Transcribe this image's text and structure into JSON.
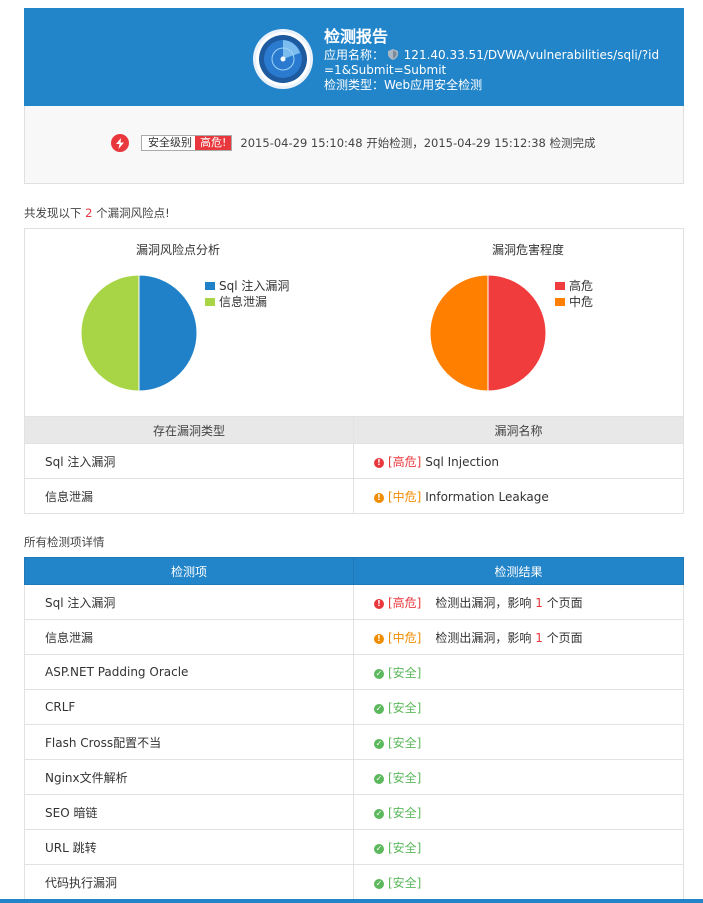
{
  "header": {
    "title": "检测报告",
    "app_name_label": "应用名称：",
    "app_url": "121.40.33.51/DVWA/vulnerabilities/sqli/?id=1&Submit=Submit",
    "scan_type_label": "检测类型：",
    "scan_type": "Web应用安全检测"
  },
  "summary": {
    "level_label": "安全级别",
    "level_value": "高危!",
    "time_text": "2015-04-29 15:10:48 开始检测，2015-04-29 15:12:38 检测完成"
  },
  "found": {
    "prefix": "共发现以下 ",
    "count": "2",
    "suffix": " 个漏洞风险点!"
  },
  "chart_data": [
    {
      "type": "pie",
      "title": "漏洞风险点分析",
      "categories": [
        "Sql 注入漏洞",
        "信息泄漏"
      ],
      "values": [
        1,
        1
      ],
      "colors": [
        "#2081c8",
        "#a8d545"
      ],
      "legend": "right"
    },
    {
      "type": "pie",
      "title": "漏洞危害程度",
      "categories": [
        "高危",
        "中危"
      ],
      "values": [
        1,
        1
      ],
      "colors": [
        "#f03c3c",
        "#ff7f00"
      ],
      "legend": "right"
    }
  ],
  "vuln_table": {
    "headers": [
      "存在漏洞类型",
      "漏洞名称"
    ],
    "rows": [
      {
        "type": "Sql 注入漏洞",
        "level": "高危",
        "tag": "[高危]",
        "name": "Sql Injection"
      },
      {
        "type": "信息泄漏",
        "level": "中危",
        "tag": "[中危]",
        "name": "Information Leakage"
      }
    ]
  },
  "details": {
    "label": "所有检测项详情",
    "headers": [
      "检测项",
      "检测结果"
    ],
    "rows": [
      {
        "item": "Sql 注入漏洞",
        "status": "high",
        "tag": "[高危]",
        "result_prefix": "检测出漏洞，影响 ",
        "count": "1",
        "result_suffix": " 个页面"
      },
      {
        "item": "信息泄漏",
        "status": "mid",
        "tag": "[中危]",
        "result_prefix": "检测出漏洞，影响 ",
        "count": "1",
        "result_suffix": " 个页面"
      },
      {
        "item": "ASP.NET Padding Oracle",
        "status": "safe",
        "tag": "[安全]"
      },
      {
        "item": "CRLF",
        "status": "safe",
        "tag": "[安全]"
      },
      {
        "item": "Flash Cross配置不当",
        "status": "safe",
        "tag": "[安全]"
      },
      {
        "item": "Nginx文件解析",
        "status": "safe",
        "tag": "[安全]"
      },
      {
        "item": "SEO 暗链",
        "status": "safe",
        "tag": "[安全]"
      },
      {
        "item": "URL 跳转",
        "status": "safe",
        "tag": "[安全]"
      },
      {
        "item": "代码执行漏洞",
        "status": "safe",
        "tag": "[安全]"
      }
    ]
  }
}
